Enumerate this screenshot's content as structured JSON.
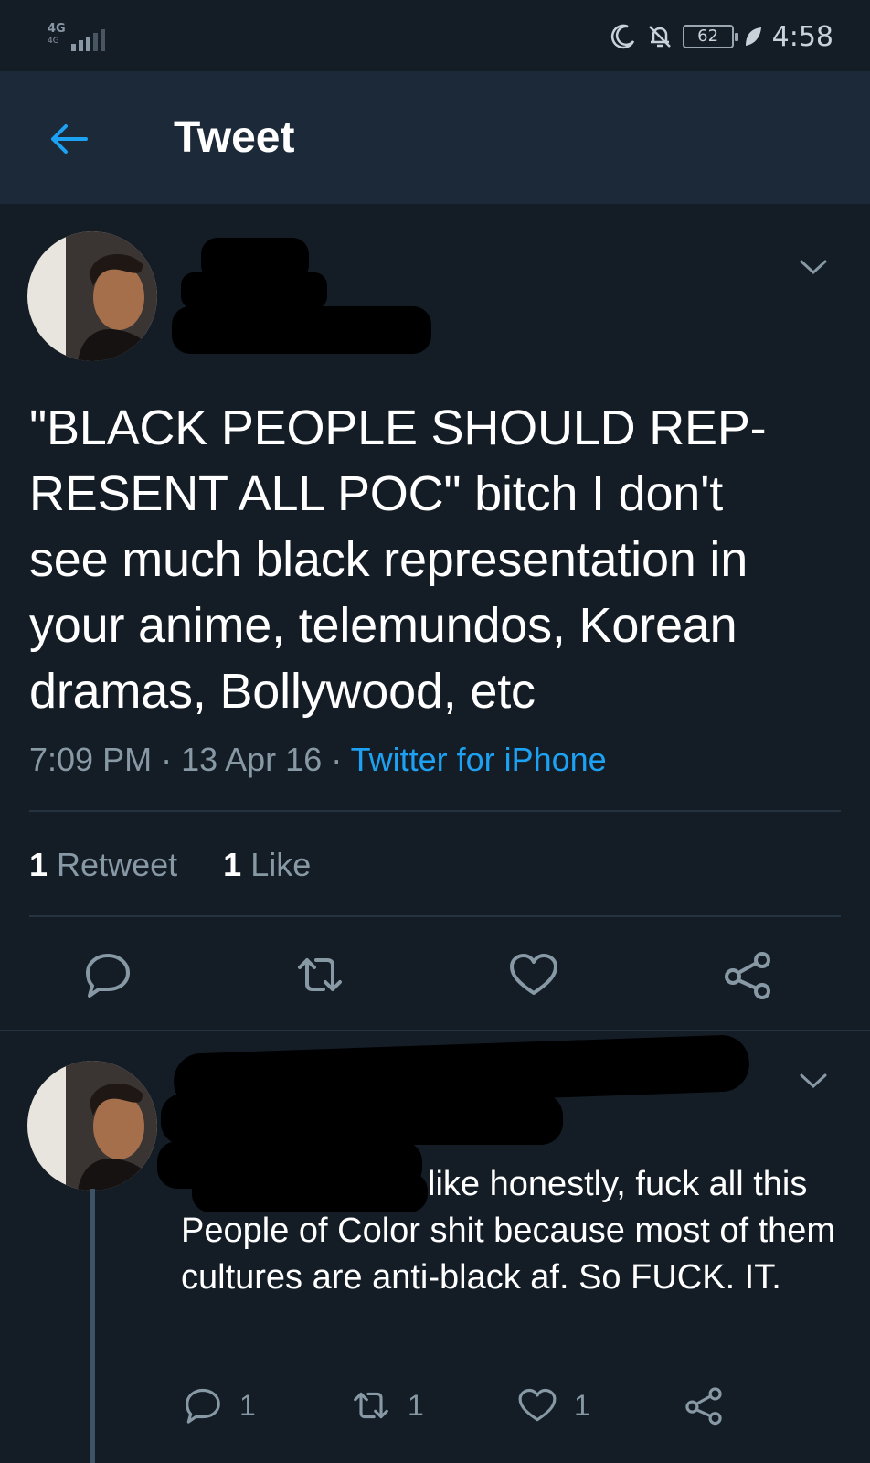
{
  "status_bar": {
    "network": "4G",
    "network_sub": "4G",
    "battery": "62",
    "time": "4:58"
  },
  "header": {
    "title": "Tweet"
  },
  "tweet": {
    "text": "\"BLACK PEOPLE SHOULD REP-\nRESENT ALL POC\" bitch I don't\nsee much black representation in\nyour anime, telemundos, Korean\ndramas, Bollywood, etc",
    "time": "7:09 PM",
    "date": "13 Apr 16",
    "source": "Twitter for iPhone",
    "retweet_count": "1",
    "retweet_label": "Retweet",
    "like_count": "1",
    "like_label": "Like"
  },
  "reply": {
    "mention": "@",
    "text": "like honestly, fuck all this People of Color shit because most of them cultures are anti-black af. So FUCK. IT.",
    "reply_count": "1",
    "retweet_count": "1",
    "like_count": "1"
  },
  "colors": {
    "background": "#141d26",
    "header": "#1c2938",
    "accent": "#1da1f2",
    "muted": "#8899a6"
  }
}
